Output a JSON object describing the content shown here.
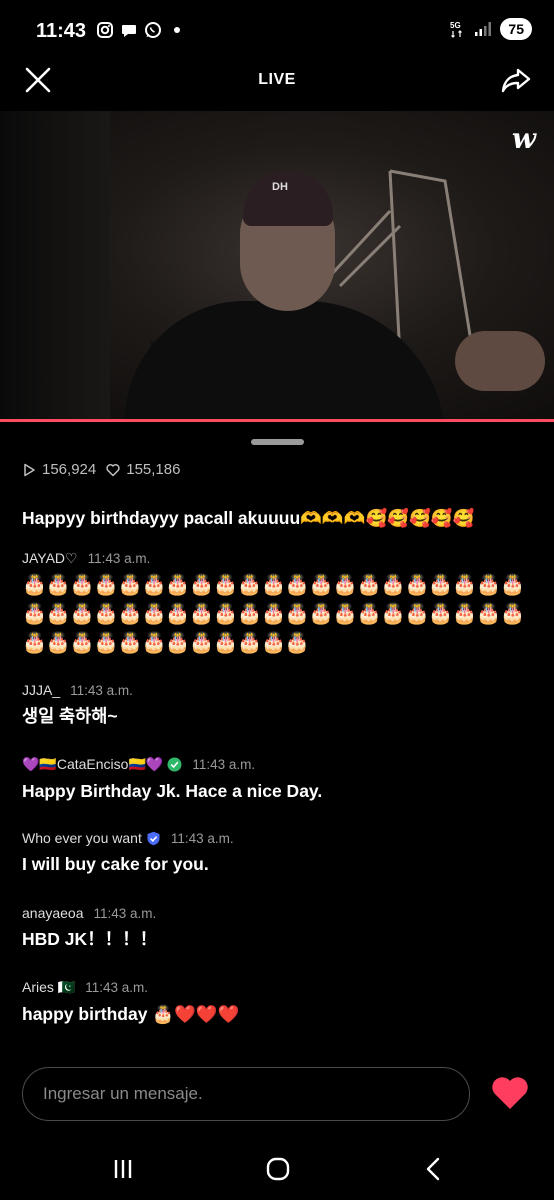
{
  "status": {
    "time": "11:43",
    "network": "5G",
    "battery": "75"
  },
  "header": {
    "title": "LIVE"
  },
  "video": {
    "logo": "w",
    "cap_text": "DH"
  },
  "stats": {
    "plays": "156,924",
    "likes": "155,186"
  },
  "chat": [
    {
      "user": "",
      "time": "",
      "text": "Happyy birthdayyy pacall akuuuu🫶🫶🫶🥰🥰🥰🥰🥰"
    },
    {
      "user": "JAYAD♡",
      "time": "11:43 a.m.",
      "text": "🎂🎂🎂🎂🎂🎂🎂🎂🎂🎂🎂🎂🎂🎂🎂🎂🎂🎂🎂🎂🎂🎂🎂🎂🎂🎂🎂🎂🎂🎂🎂🎂🎂🎂🎂🎂🎂🎂🎂🎂🎂🎂🎂🎂🎂🎂🎂🎂🎂🎂🎂🎂🎂🎂"
    },
    {
      "user": "JJJA_",
      "time": "11:43 a.m.",
      "text": "생일 축하해~"
    },
    {
      "user": "💜🇨🇴CataEnciso🇨🇴💜",
      "time": "11:43 a.m.",
      "text": "Happy Birthday Jk. Hace a nice Day."
    },
    {
      "user": "Who ever you want",
      "time": "11:43 a.m.",
      "text": "I will buy cake for you."
    },
    {
      "user": "anayaeoa",
      "time": "11:43 a.m.",
      "text": "HBD JK！！！！"
    },
    {
      "user": "Aries 🇵🇰",
      "time": "11:43 a.m.",
      "text": "happy birthday 🎂❤️❤️❤️"
    }
  ],
  "input": {
    "placeholder": "Ingresar un mensaje."
  },
  "colors": {
    "accent": "#ff4d5f",
    "heart": "#ff3e5f"
  },
  "icons": [
    "instagram-icon",
    "chat-icon",
    "whatsapp-icon",
    "close-icon",
    "share-icon",
    "play-icon",
    "heart-outline-icon",
    "heart-icon",
    "verified-badge-icon",
    "nav-recents-icon",
    "nav-home-icon",
    "nav-back-icon"
  ]
}
